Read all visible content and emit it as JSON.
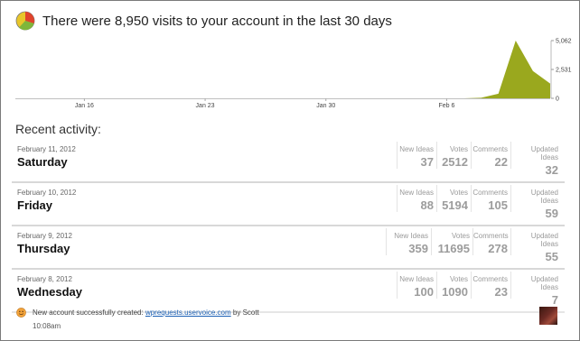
{
  "header": {
    "title": "There were 8,950 visits to your account in the last 30 days",
    "icon": "pie-chart-icon"
  },
  "chart_data": {
    "type": "area",
    "x_ticks": [
      "Jan 16",
      "Jan 23",
      "Jan 30",
      "Feb 6"
    ],
    "y_ticks": [
      "5,062",
      "2,531",
      "0"
    ],
    "ylim": [
      0,
      5062
    ],
    "x_count": 31,
    "values": [
      0,
      0,
      0,
      0,
      0,
      0,
      0,
      0,
      0,
      0,
      0,
      0,
      0,
      0,
      0,
      0,
      0,
      0,
      0,
      0,
      0,
      0,
      0,
      0,
      0,
      0,
      0,
      50,
      400,
      5062,
      2400,
      1300
    ],
    "color": "#9aa81e"
  },
  "section_title": "Recent activity:",
  "stat_labels": {
    "new_ideas": "New Ideas",
    "votes": "Votes",
    "comments": "Comments",
    "updated_ideas": "Updated Ideas"
  },
  "days": [
    {
      "date": "February 11, 2012",
      "name": "Saturday",
      "new_ideas": "37",
      "votes": "2512",
      "comments": "22",
      "updated_ideas": "32"
    },
    {
      "date": "February 10, 2012",
      "name": "Friday",
      "new_ideas": "88",
      "votes": "5194",
      "comments": "105",
      "updated_ideas": "59"
    },
    {
      "date": "February 9, 2012",
      "name": "Thursday",
      "new_ideas": "359",
      "votes": "11695",
      "comments": "278",
      "updated_ideas": "55"
    },
    {
      "date": "February 8, 2012",
      "name": "Wednesday",
      "new_ideas": "100",
      "votes": "1090",
      "comments": "23",
      "updated_ideas": "7"
    }
  ],
  "activity": {
    "text_before": "New account successfully created: ",
    "link": "wprequests.uservoice.com",
    "text_after": " by Scott",
    "time": "10:08am"
  }
}
